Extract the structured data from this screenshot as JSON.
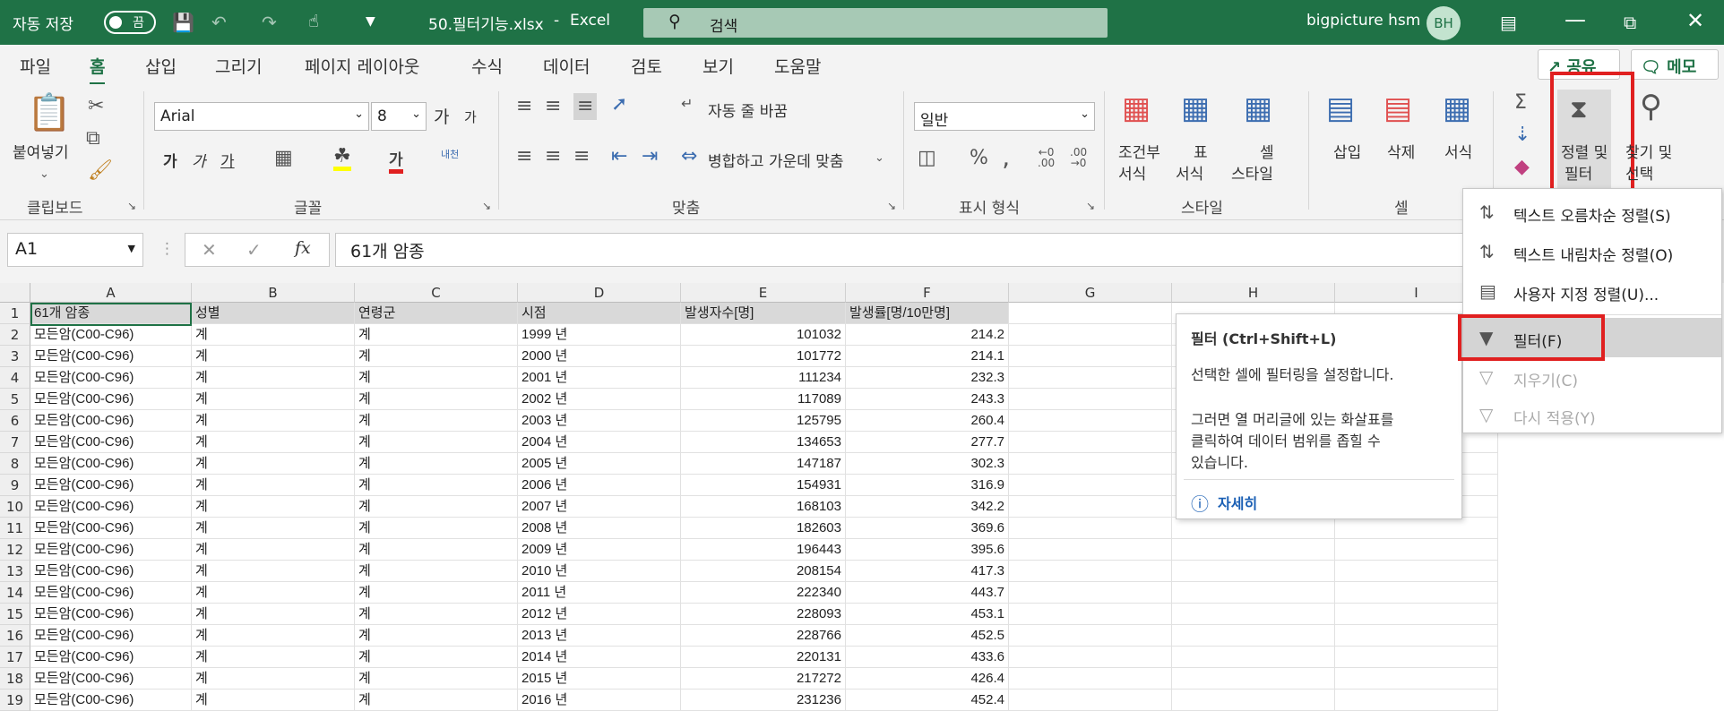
{
  "titlebar": {
    "autosave_label": "자동 저장",
    "autosave_state": "끔",
    "filename": "50.필터기능.xlsx",
    "separator": "-",
    "app_name": "Excel",
    "search_placeholder": "검색",
    "user_name": "bigpicture hsm",
    "user_initials": "BH",
    "accent": "#1f7246"
  },
  "tabs": [
    "파일",
    "홈",
    "삽입",
    "그리기",
    "페이지 레이아웃",
    "수식",
    "데이터",
    "검토",
    "보기",
    "도움말"
  ],
  "share_label": "공유",
  "memo_label": "메모",
  "ribbon": {
    "clipboard": {
      "paste": "붙여넣기",
      "label": "클립보드"
    },
    "font": {
      "name": "Arial",
      "size": "8",
      "label": "글꼴",
      "bold": "가",
      "italic": "가",
      "underline": "가",
      "grow": "가",
      "shrink": "가",
      "phonetic": "내천"
    },
    "align": {
      "wrap": "자동 줄 바꿈",
      "merge": "병합하고 가운데 맞춤",
      "label": "맞춤"
    },
    "number": {
      "format": "일반",
      "label": "표시 형식"
    },
    "styles": {
      "cond1": "조건부",
      "cond2": "서식",
      "table1": "표",
      "table2": "서식",
      "cell1": "셀",
      "cell2": "스타일",
      "label": "스타일"
    },
    "cells": {
      "insert": "삽입",
      "delete": "삭제",
      "format": "서식",
      "label": "셀"
    },
    "editing": {
      "sort1": "정렬 및",
      "sort2": "필터",
      "find1": "찾기 및",
      "find2": "선택"
    }
  },
  "formula_bar": {
    "name_box": "A1",
    "fx": "fx",
    "content": "61개 암종"
  },
  "columns": [
    "A",
    "B",
    "C",
    "D",
    "E",
    "F",
    "G",
    "H",
    "I"
  ],
  "header_row": [
    "61개 암종",
    "성별",
    "연령군",
    "시점",
    "발생자수[명]",
    "발생률[명/10만명]"
  ],
  "rows": [
    [
      "모든암(C00-C96)",
      "계",
      "계",
      "1999 년",
      "101032",
      "214.2"
    ],
    [
      "모든암(C00-C96)",
      "계",
      "계",
      "2000 년",
      "101772",
      "214.1"
    ],
    [
      "모든암(C00-C96)",
      "계",
      "계",
      "2001 년",
      "111234",
      "232.3"
    ],
    [
      "모든암(C00-C96)",
      "계",
      "계",
      "2002 년",
      "117089",
      "243.3"
    ],
    [
      "모든암(C00-C96)",
      "계",
      "계",
      "2003 년",
      "125795",
      "260.4"
    ],
    [
      "모든암(C00-C96)",
      "계",
      "계",
      "2004 년",
      "134653",
      "277.7"
    ],
    [
      "모든암(C00-C96)",
      "계",
      "계",
      "2005 년",
      "147187",
      "302.3"
    ],
    [
      "모든암(C00-C96)",
      "계",
      "계",
      "2006 년",
      "154931",
      "316.9"
    ],
    [
      "모든암(C00-C96)",
      "계",
      "계",
      "2007 년",
      "168103",
      "342.2"
    ],
    [
      "모든암(C00-C96)",
      "계",
      "계",
      "2008 년",
      "182603",
      "369.6"
    ],
    [
      "모든암(C00-C96)",
      "계",
      "계",
      "2009 년",
      "196443",
      "395.6"
    ],
    [
      "모든암(C00-C96)",
      "계",
      "계",
      "2010 년",
      "208154",
      "417.3"
    ],
    [
      "모든암(C00-C96)",
      "계",
      "계",
      "2011 년",
      "222340",
      "443.7"
    ],
    [
      "모든암(C00-C96)",
      "계",
      "계",
      "2012 년",
      "228093",
      "453.1"
    ],
    [
      "모든암(C00-C96)",
      "계",
      "계",
      "2013 년",
      "228766",
      "452.5"
    ],
    [
      "모든암(C00-C96)",
      "계",
      "계",
      "2014 년",
      "220131",
      "433.6"
    ],
    [
      "모든암(C00-C96)",
      "계",
      "계",
      "2015 년",
      "217272",
      "426.4"
    ],
    [
      "모든암(C00-C96)",
      "계",
      "계",
      "2016 년",
      "231236",
      "452.4"
    ]
  ],
  "tooltip": {
    "title": "필터 (Ctrl+Shift+L)",
    "line1": "선택한 셀에 필터링을 설정합니다.",
    "line2": "그러면 열 머리글에 있는 화살표를",
    "line3": "클릭하여 데이터 범위를 좁힐 수",
    "line4": "있습니다.",
    "more": "자세히"
  },
  "sort_menu": {
    "asc": "텍스트 오름차순 정렬(S)",
    "desc": "텍스트 내림차순 정렬(O)",
    "custom": "사용자 지정 정렬(U)...",
    "filter": "필터(F)",
    "clear": "지우기(C)",
    "reapply": "다시 적용(Y)"
  },
  "highlight_color": "#e02020"
}
